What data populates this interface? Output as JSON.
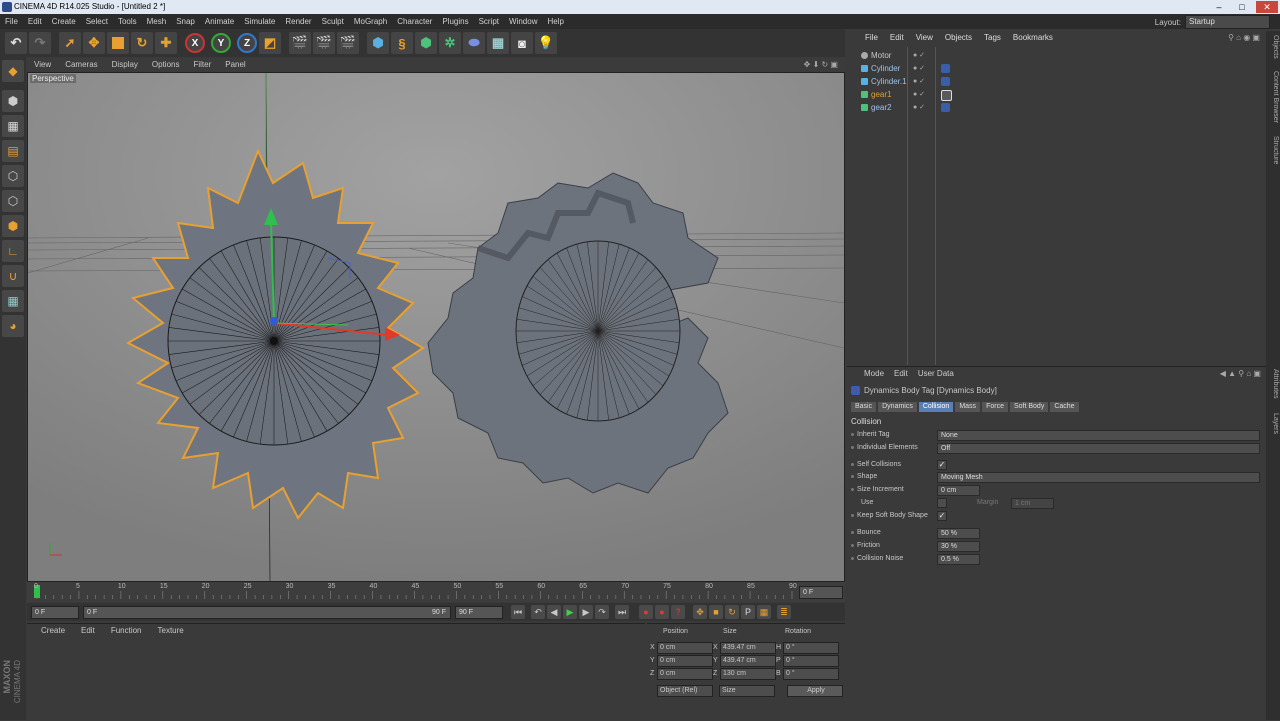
{
  "window": {
    "title": "CINEMA 4D R14.025 Studio - [Untitled 2 *]",
    "controls": [
      "–",
      "□",
      "✕"
    ]
  },
  "menubar": {
    "items": [
      "File",
      "Edit",
      "Create",
      "Select",
      "Tools",
      "Mesh",
      "Snap",
      "Animate",
      "Simulate",
      "Render",
      "Sculpt",
      "MoGraph",
      "Character",
      "Plugins",
      "Script",
      "Window",
      "Help"
    ],
    "layout_label": "Layout:",
    "layout_value": "Startup"
  },
  "toolbar": {
    "axis_x": "X",
    "axis_y": "Y",
    "axis_z": "Z"
  },
  "viewport": {
    "menu": [
      "View",
      "Cameras",
      "Display",
      "Options",
      "Filter",
      "Panel"
    ],
    "camera_label": "Perspective"
  },
  "timeline": {
    "ticks": [
      "0",
      "5",
      "10",
      "15",
      "20",
      "25",
      "30",
      "35",
      "40",
      "45",
      "50",
      "55",
      "60",
      "65",
      "70",
      "75",
      "80",
      "85",
      "90"
    ],
    "end_field": "0 F",
    "current_frame": "0 F",
    "range_start": "0 F",
    "range_end_inner": "90 F",
    "range_end": "90 F"
  },
  "material_manager": {
    "menu": [
      "Create",
      "Edit",
      "Function",
      "Texture"
    ]
  },
  "branding": {
    "maxon": "MAXON",
    "product": "CINEMA 4D"
  },
  "coordinates": {
    "headers": [
      "Position",
      "Size",
      "Rotation"
    ],
    "rows": [
      {
        "axis": "X",
        "pos": "0 cm",
        "size_axis": "X",
        "size": "439.47 cm",
        "rot_axis": "H",
        "rot": "0 °"
      },
      {
        "axis": "Y",
        "pos": "0 cm",
        "size_axis": "Y",
        "size": "439.47 cm",
        "rot_axis": "P",
        "rot": "0 °"
      },
      {
        "axis": "Z",
        "pos": "0 cm",
        "size_axis": "Z",
        "size": "130 cm",
        "rot_axis": "B",
        "rot": "0 °"
      }
    ],
    "mode_select": "Object (Rel)",
    "size_select": "Size",
    "apply": "Apply"
  },
  "object_manager": {
    "menu": [
      "File",
      "Edit",
      "View",
      "Objects",
      "Tags",
      "Bookmarks"
    ],
    "objects": [
      {
        "name": "Motor",
        "color": "#c8c8c8"
      },
      {
        "name": "Cylinder",
        "color": "#9fc3e8"
      },
      {
        "name": "Cylinder.1",
        "color": "#9fc3e8"
      },
      {
        "name": "gear1",
        "color": "#e0a030"
      },
      {
        "name": "gear2",
        "color": "#9fc3e8"
      }
    ]
  },
  "right_tabs": [
    "Objects",
    "Content Browser",
    "Structure",
    "Attributes",
    "Layers"
  ],
  "attributes": {
    "menu": [
      "Mode",
      "Edit",
      "User Data"
    ],
    "header": "Dynamics Body Tag [Dynamics Body]",
    "tabs": [
      "Basic",
      "Dynamics",
      "Collision",
      "Mass",
      "Force",
      "Soft Body",
      "Cache"
    ],
    "active_tab": "Collision",
    "section": "Collision",
    "fields": {
      "inherit_tag_label": "Inherit Tag",
      "inherit_tag_value": "None",
      "individual_label": "Individual Elements",
      "individual_value": "Off",
      "self_collisions_label": "Self Collisions",
      "self_collisions_value": "✓",
      "shape_label": "Shape",
      "shape_value": "Moving Mesh",
      "size_increment_label": "Size Increment",
      "size_increment_value": "0 cm",
      "use_label": "Use",
      "margin_label": "Margin",
      "margin_value": "1 cm",
      "keep_soft_label": "Keep Soft Body Shape",
      "keep_soft_value": "✓",
      "bounce_label": "Bounce",
      "bounce_value": "50 %",
      "friction_label": "Friction",
      "friction_value": "30 %",
      "noise_label": "Collision Noise",
      "noise_value": "0.5 %"
    }
  }
}
